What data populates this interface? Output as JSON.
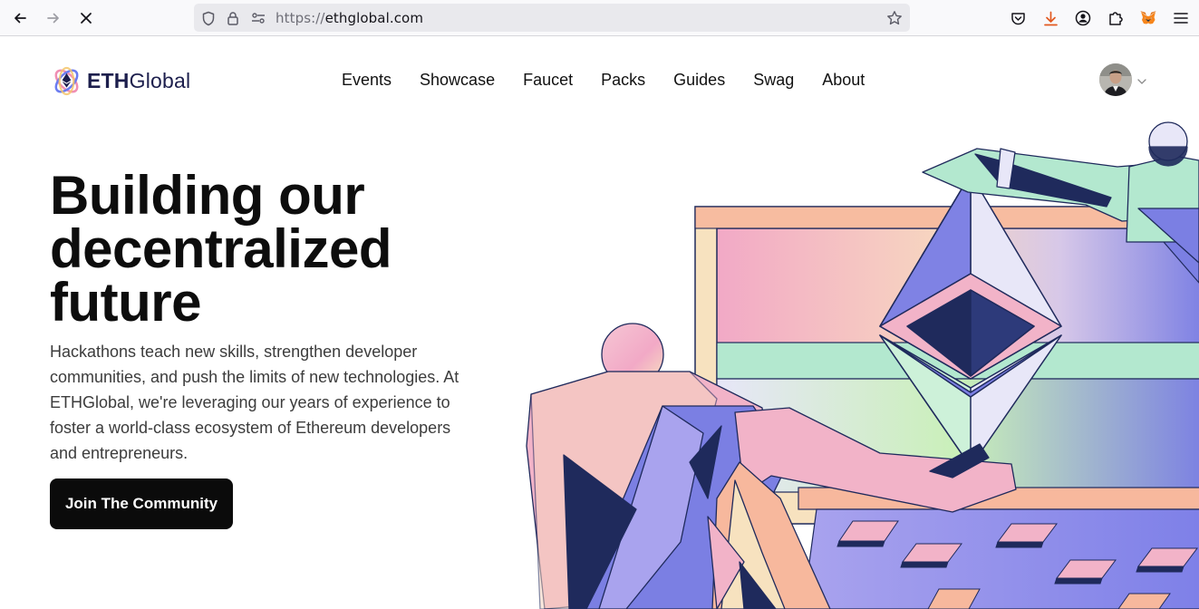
{
  "browser": {
    "url_scheme": "https://",
    "url_host": "ethglobal.com",
    "icons": [
      "back-icon",
      "forward-icon",
      "stop-icon",
      "shield-icon",
      "lock-icon",
      "permissions-icon",
      "bookmark-star-icon",
      "pocket-icon",
      "downloads-icon",
      "account-icon",
      "extensions-icon",
      "metamask-icon",
      "menu-icon"
    ]
  },
  "header": {
    "logo_bold": "ETH",
    "logo_regular": "Global",
    "nav": [
      "Events",
      "Showcase",
      "Faucet",
      "Packs",
      "Guides",
      "Swag",
      "About"
    ]
  },
  "hero": {
    "title_line1": "Building our",
    "title_line2": "decentralized",
    "title_line3": "future",
    "description": "Hackathons teach new skills, strengthen developer communities, and push the limits of new technologies. At ETHGlobal, we're leveraging our years of experience to foster a world-class ecosystem of Ethereum developers and entrepreneurs.",
    "cta_label": "Join The Community"
  },
  "colors": {
    "brand_navy": "#1d1f4d",
    "cta_bg": "#0b0b0b",
    "illustration_pink": "#f2b3c8",
    "illustration_mint": "#b3e8cf",
    "illustration_blue": "#7b7fe3",
    "illustration_navy": "#1f2a5c",
    "illustration_cream": "#f7e2bf",
    "illustration_peach": "#f7b89d"
  }
}
